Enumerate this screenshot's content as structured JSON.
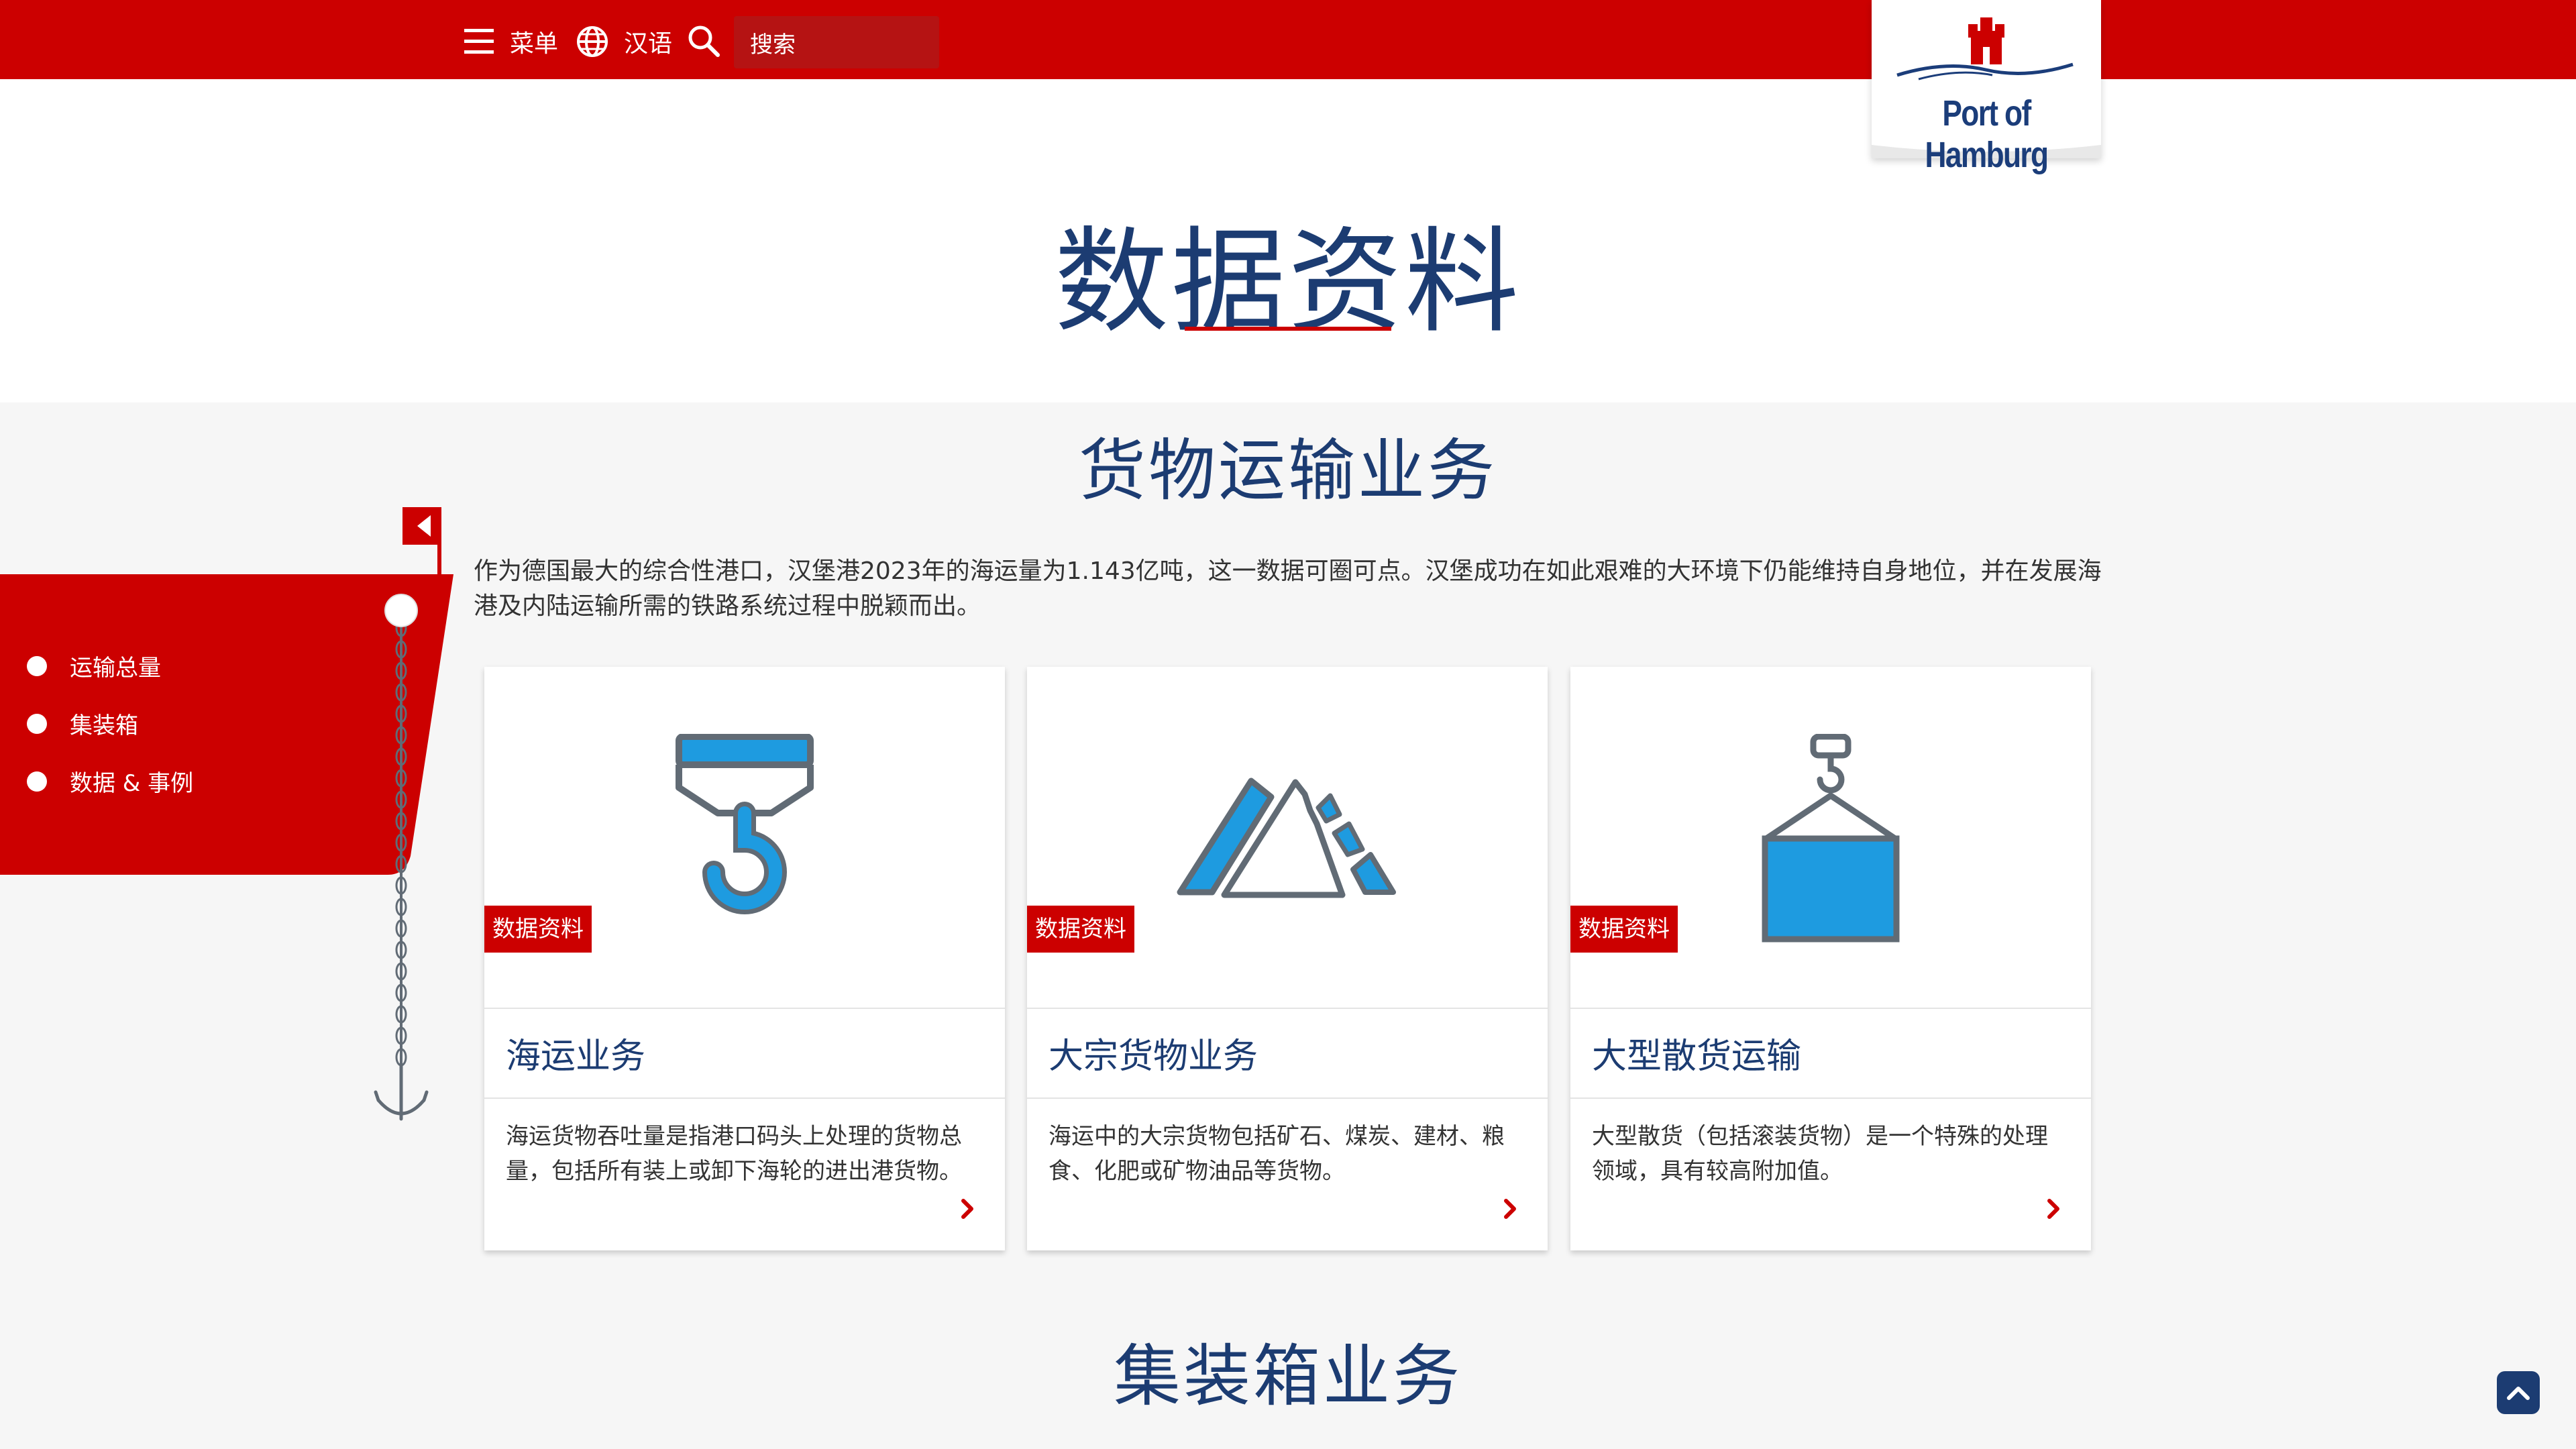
{
  "header": {
    "menu_label": "菜单",
    "language_label": "汉语",
    "search_placeholder": "搜索"
  },
  "logo": {
    "text": "Port of Hamburg"
  },
  "page": {
    "title": "数据资料"
  },
  "section": {
    "title": "货物运输业务",
    "intro": "作为德国最大的综合性港口，汉堡港2023年的海运量为1.143亿吨，这一数据可圈可点。汉堡成功在如此艰难的大环境下仍能维持自身地位，并在发展海港及内陆运输所需的铁路系统过程中脱颖而出。"
  },
  "sidebar": {
    "items": [
      {
        "label": "运输总量"
      },
      {
        "label": "集装箱"
      },
      {
        "label": "数据 & 事例"
      }
    ]
  },
  "cards": [
    {
      "badge": "数据资料",
      "title": "海运业务",
      "description": "海运货物吞吐量是指港口码头上处理的货物总量，包括所有装上或卸下海轮的进出港货物。",
      "icon": "crane-hook-icon"
    },
    {
      "badge": "数据资料",
      "title": "大宗货物业务",
      "description": "海运中的大宗货物包括矿石、煤炭、建材、粮食、化肥或矿物油品等货物。",
      "icon": "bulk-pile-icon"
    },
    {
      "badge": "数据资料",
      "title": "大型散货运输",
      "description": "大型散货（包括滚装货物）是一个特殊的处理领域，具有较高附加值。",
      "icon": "hanging-cargo-icon"
    }
  ],
  "section2": {
    "title": "集装箱业务"
  },
  "colors": {
    "brand_red": "#cc0000",
    "navy": "#1c3c72",
    "icon_blue": "#1e9be0",
    "icon_grey": "#616b75"
  }
}
